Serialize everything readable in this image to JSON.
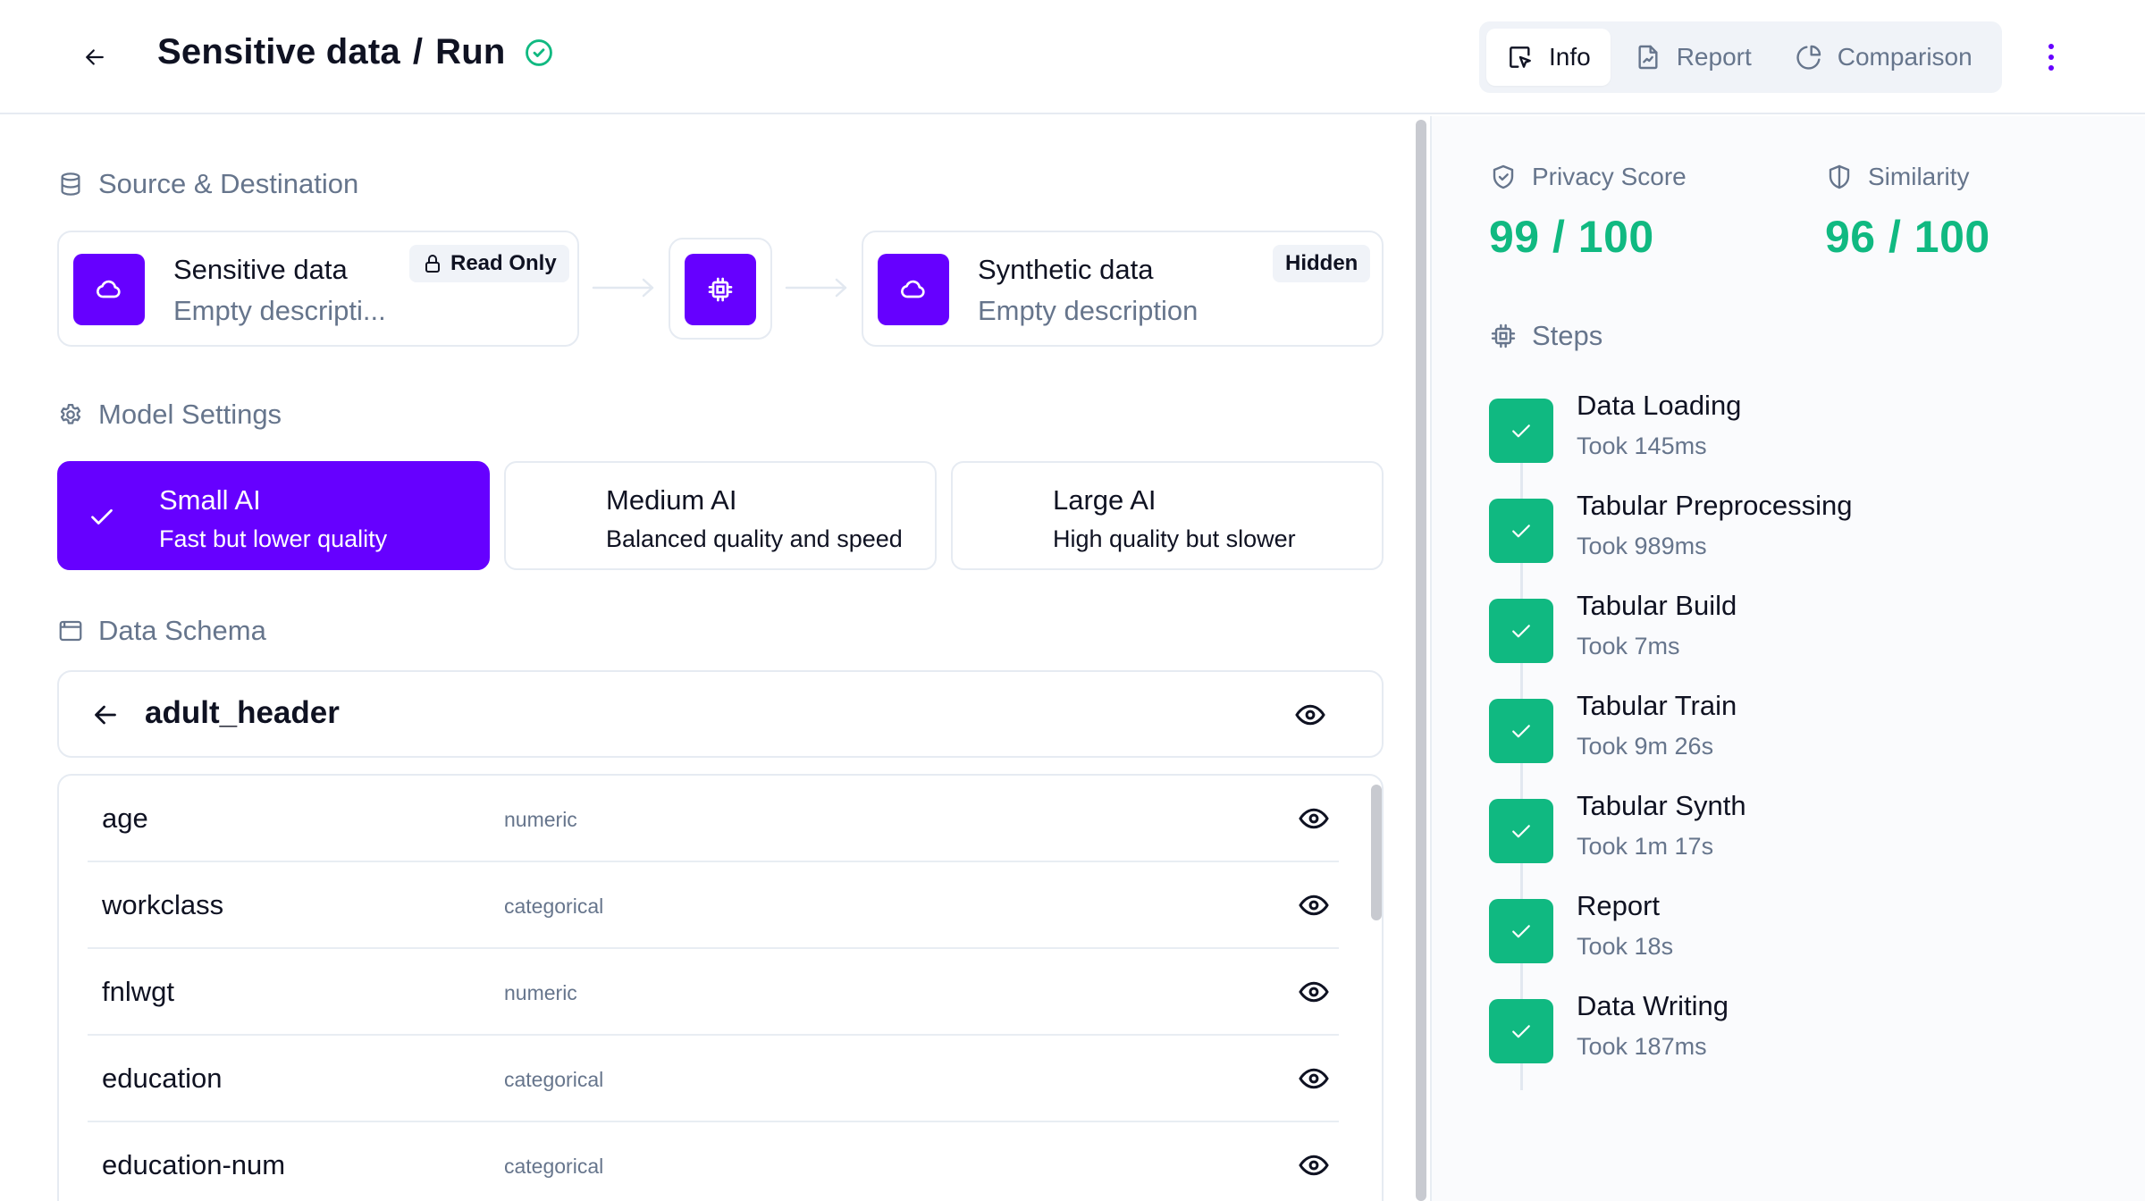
{
  "header": {
    "title": "Sensitive data",
    "separator": "/",
    "subtitle": "Run",
    "status": "completed",
    "tabs": [
      {
        "label": "Info",
        "icon": "cursor-window-icon",
        "active": true
      },
      {
        "label": "Report",
        "icon": "file-chart-icon",
        "active": false
      },
      {
        "label": "Comparison",
        "icon": "pie-chart-icon",
        "active": false
      }
    ]
  },
  "colors": {
    "accent": "#6600ff",
    "success": "#10b981",
    "muted_text": "#66758c",
    "text": "#0f1222",
    "border": "#e6ebf2"
  },
  "source_destination": {
    "title": "Source & Destination",
    "source": {
      "name": "Sensitive data",
      "description": "Empty descripti...",
      "badge": "Read Only"
    },
    "destination": {
      "name": "Synthetic data",
      "description": "Empty description",
      "badge": "Hidden"
    }
  },
  "model_settings": {
    "title": "Model Settings",
    "options": [
      {
        "name": "Small AI",
        "description": "Fast but lower quality",
        "selected": true
      },
      {
        "name": "Medium AI",
        "description": "Balanced quality and speed",
        "selected": false
      },
      {
        "name": "Large AI",
        "description": "High quality but slower",
        "selected": false
      }
    ]
  },
  "data_schema": {
    "title": "Data Schema",
    "table_name": "adult_header",
    "columns": [
      {
        "name": "age",
        "type": "numeric"
      },
      {
        "name": "workclass",
        "type": "categorical"
      },
      {
        "name": "fnlwgt",
        "type": "numeric"
      },
      {
        "name": "education",
        "type": "categorical"
      },
      {
        "name": "education-num",
        "type": "categorical"
      }
    ]
  },
  "metrics": {
    "privacy": {
      "label": "Privacy Score",
      "value": "99 / 100"
    },
    "similarity": {
      "label": "Similarity",
      "value": "96 / 100"
    }
  },
  "steps": {
    "title": "Steps",
    "items": [
      {
        "name": "Data Loading",
        "took": "Took 145ms"
      },
      {
        "name": "Tabular Preprocessing",
        "took": "Took 989ms"
      },
      {
        "name": "Tabular Build",
        "took": "Took 7ms"
      },
      {
        "name": "Tabular Train",
        "took": "Took 9m 26s"
      },
      {
        "name": "Tabular Synth",
        "took": "Took 1m 17s"
      },
      {
        "name": "Report",
        "took": "Took 18s"
      },
      {
        "name": "Data Writing",
        "took": "Took 187ms"
      }
    ]
  }
}
